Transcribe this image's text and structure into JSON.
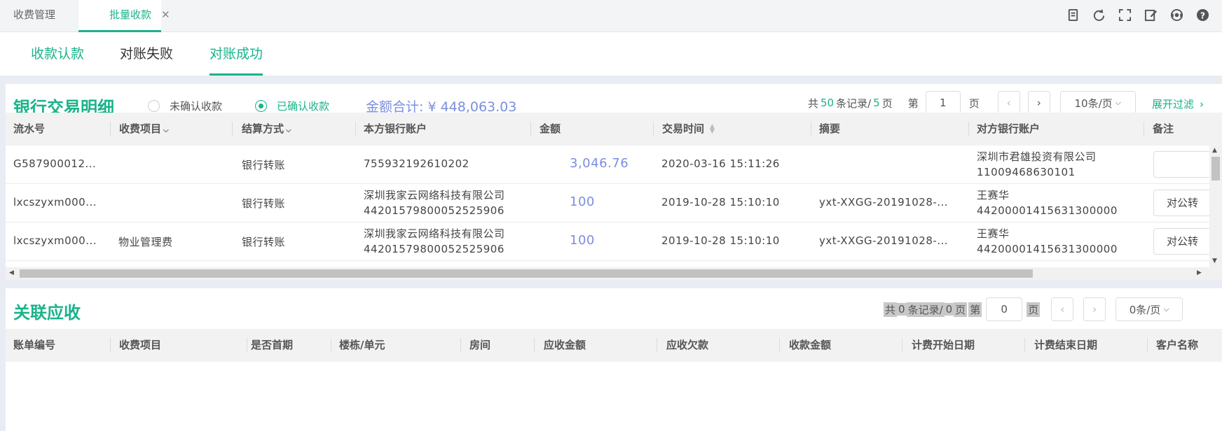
{
  "tabs": [
    {
      "label": "收费管理",
      "active": false
    },
    {
      "label": "批量收款",
      "active": true,
      "close": "✕"
    }
  ],
  "toolbar_icons": [
    "document-icon",
    "refresh-icon",
    "fullscreen-icon",
    "edit-icon",
    "support-icon",
    "help-icon"
  ],
  "subtabs": [
    {
      "label": "收款认款"
    },
    {
      "label": "对账失败"
    },
    {
      "label": "对账成功"
    }
  ],
  "bank_panel": {
    "title": "银行交易明细",
    "radio_unconfirmed": "未确认收款",
    "radio_confirmed": "已确认收款",
    "selected_radio": "已确认收款",
    "total_label": "金额合计: ¥ 448,063.03",
    "pager": {
      "prefix": "共",
      "records": "50",
      "records_label": "条记录/",
      "pages": "5",
      "pages_label": "页",
      "page_prefix": "第",
      "current_page": "1",
      "page_suffix": "页",
      "page_size": "10条/页"
    },
    "expand_filter": "展开过滤",
    "columns": [
      "流水号",
      "收费项目",
      "结算方式",
      "本方银行账户",
      "金额",
      "交易时间",
      "摘要",
      "对方银行账户",
      "备注"
    ],
    "rows": [
      {
        "serial": "G587900012...",
        "item": "",
        "method": "银行转账",
        "own_account_name": "",
        "own_account": "755932192610202",
        "amount": "3,046.76",
        "time": "2020-03-16 15:11:26",
        "summary": "",
        "peer_name": "深圳市君雄投资有限公司",
        "peer_account": "11009468630101",
        "remark": ""
      },
      {
        "serial": "lxcszyxm000...",
        "item": "",
        "method": "银行转账",
        "own_account_name": "深圳我家云网络科技有限公司",
        "own_account": "44201579800052525906",
        "amount": "100",
        "time": "2019-10-28 15:10:10",
        "summary": "yxt-XXGG-20191028-...",
        "peer_name": "王赛华",
        "peer_account": "44200001415631300000",
        "remark": "对公转"
      },
      {
        "serial": "lxcszyxm000...",
        "item": "物业管理费",
        "method": "银行转账",
        "own_account_name": "深圳我家云网络科技有限公司",
        "own_account": "44201579800052525906",
        "amount": "100",
        "time": "2019-10-28 15:10:10",
        "summary": "yxt-XXGG-20191028-...",
        "peer_name": "王赛华",
        "peer_account": "44200001415631300000",
        "remark": "对公转"
      }
    ]
  },
  "receivable_panel": {
    "title": "关联应收",
    "pager": {
      "prefix": "共",
      "records": "0",
      "records_label": "条记录/",
      "pages": "0",
      "pages_label": "页",
      "page_prefix": "第",
      "current_page": "0",
      "page_suffix": "页",
      "page_size": "0条/页"
    },
    "columns": [
      "账单编号",
      "收费项目",
      "是否首期",
      "楼栋/单元",
      "房间",
      "应收金额",
      "应收欠款",
      "收款金额",
      "计费开始日期",
      "计费结束日期",
      "客户名称"
    ]
  },
  "colors": {
    "accent": "#19b38a",
    "amount": "#7b8ee0"
  }
}
